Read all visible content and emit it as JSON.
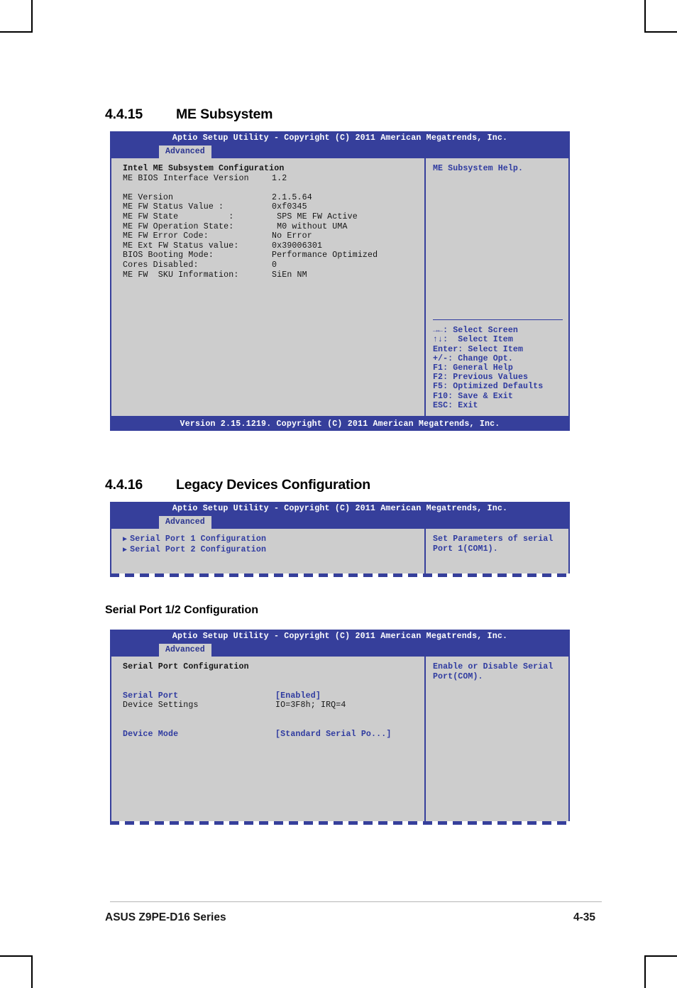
{
  "document": {
    "footer_left": "ASUS Z9PE-D16 Series",
    "footer_right": "4-35"
  },
  "sections": [
    {
      "number": "4.4.15",
      "title": "ME Subsystem"
    },
    {
      "number": "4.4.16",
      "title": "Legacy Devices Configuration"
    }
  ],
  "subheading": "Serial Port 1/2 Configuration",
  "bios_common": {
    "titlebar": "Aptio Setup Utility - Copyright (C) 2011 American Megatrends, Inc.",
    "tab": "Advanced",
    "footer": "Version 2.15.1219. Copyright (C) 2011 American Megatrends, Inc.",
    "triangle_icon": "▶"
  },
  "screen_me": {
    "heading": "Intel ME Subsystem Configuration",
    "rows": [
      {
        "label": "ME BIOS Interface Version",
        "value": "1.2"
      },
      {
        "label": "",
        "value": ""
      },
      {
        "label": "ME Version",
        "value": "2.1.5.64"
      },
      {
        "label": "ME FW Status Value :",
        "value": "0xf0345"
      },
      {
        "label": "ME FW State          :",
        "value": " SPS ME FW Active"
      },
      {
        "label": "ME FW Operation State:",
        "value": " M0 without UMA"
      },
      {
        "label": "ME FW Error Code:",
        "value": "No Error"
      },
      {
        "label": "ME Ext FW Status value:",
        "value": "0x39006301"
      },
      {
        "label": "BIOS Booting Mode:",
        "value": "Performance Optimized"
      },
      {
        "label": "Cores Disabled:",
        "value": "0"
      },
      {
        "label": "ME FW  SKU Information:",
        "value": "SiEn NM"
      }
    ],
    "help": "ME Subsystem Help.",
    "navkeys": [
      "→←: Select Screen",
      "↑↓:  Select Item",
      "Enter: Select Item",
      "+/-: Change Opt.",
      "F1: General Help",
      "F2: Previous Values",
      "F5: Optimized Defaults",
      "F10: Save & Exit",
      "ESC: Exit"
    ]
  },
  "screen_legacy": {
    "items": [
      "Serial Port 1 Configuration",
      "Serial Port 2 Configuration"
    ],
    "help": "Set Parameters of serial\nPort 1(COM1)."
  },
  "screen_serial": {
    "heading": "Serial Port Configuration",
    "rows": [
      {
        "label": "Serial Port",
        "value": "[Enabled]",
        "highlight": true
      },
      {
        "label": "Device Settings",
        "value": "IO=3F8h; IRQ=4",
        "highlight": false
      },
      {
        "label": "",
        "value": "",
        "highlight": false
      },
      {
        "label": "Device Mode",
        "value": "[Standard Serial Po...]",
        "highlight": true
      }
    ],
    "help": "Enable or Disable Serial\nPort(COM)."
  },
  "colors": {
    "bios_blue": "#363f9b",
    "bios_gray": "#cdcdcd",
    "text_blue": "#2f3ba0"
  }
}
